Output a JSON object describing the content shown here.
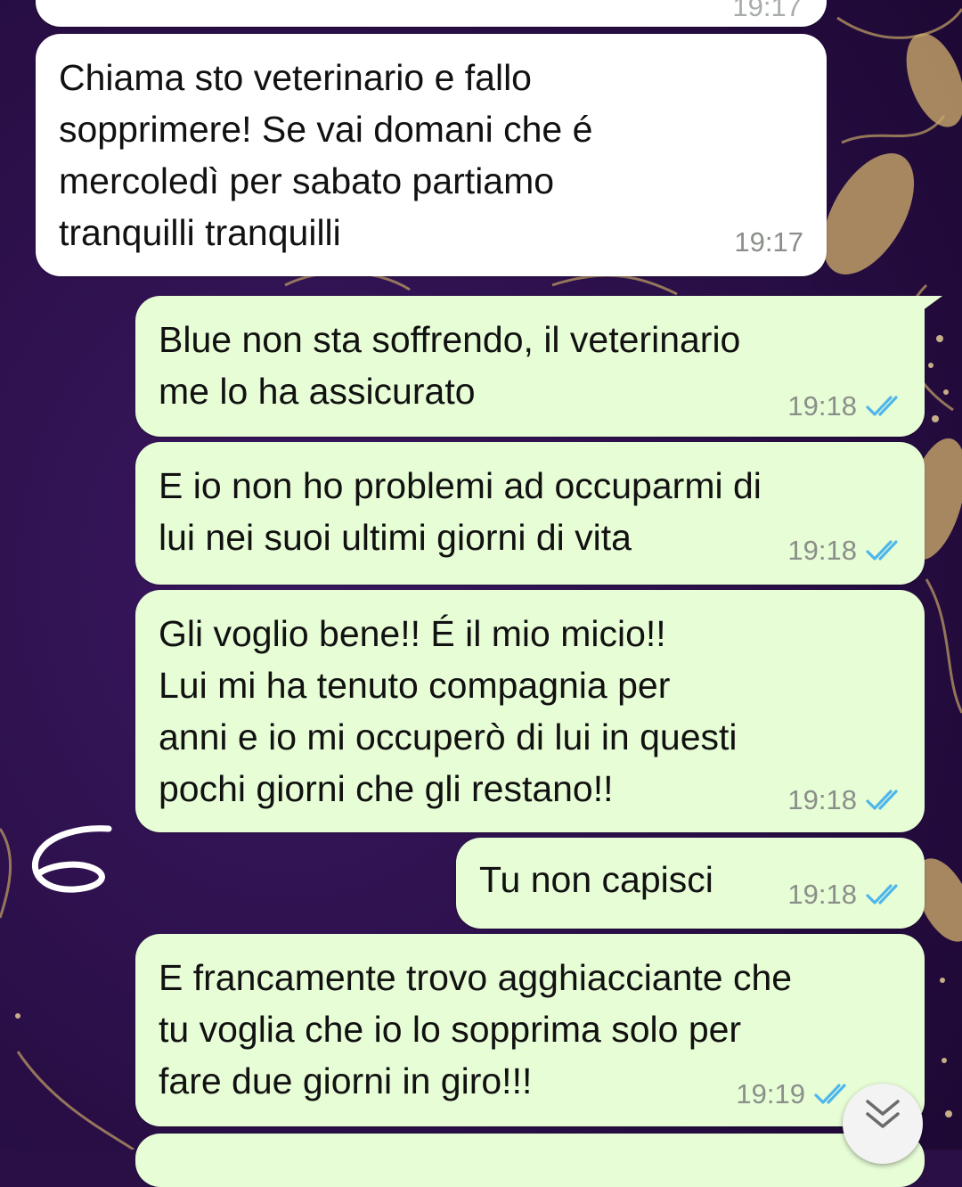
{
  "chat": {
    "messages": [
      {
        "direction": "incoming",
        "text": "Chiama sto veterinario e fallo\nsopprimere! Se vai domani che é\nmercoledì per sabato partiamo\ntranquilli tranquilli",
        "time": "19:17"
      },
      {
        "direction": "outgoing",
        "text": "Blue non sta soffrendo, il veterinario\nme lo ha assicurato",
        "time": "19:18",
        "status": "read"
      },
      {
        "direction": "outgoing",
        "text": "E io non ho problemi ad occuparmi di\nlui nei suoi ultimi giorni di vita",
        "time": "19:18",
        "status": "read"
      },
      {
        "direction": "outgoing",
        "text": "Gli voglio bene!! É il mio micio!!\nLui mi ha tenuto compagnia per\nanni e io mi occuperò di lui in questi\npochi giorni che gli restano!!",
        "time": "19:18",
        "status": "read"
      },
      {
        "direction": "outgoing",
        "text": "Tu non capisci",
        "time": "19:18",
        "status": "read"
      },
      {
        "direction": "outgoing",
        "text": "E francamente trovo agghiacciante che\ntu voglia che io lo sopprima solo per\nfare due giorni in giro!!!",
        "time": "19:19",
        "status": "read"
      }
    ],
    "top_partial_time": "19:17",
    "annotation": "6"
  },
  "icons": {
    "read_ticks": "double-check-icon",
    "scroll_down": "chevron-double-down-icon"
  },
  "colors": {
    "incoming_bubble": "#ffffff",
    "outgoing_bubble": "#e7fdd6",
    "read_ticks": "#4fb6ec",
    "wallpaper": "#2a0f45",
    "wallpaper_ornament": "#c9a76a"
  }
}
